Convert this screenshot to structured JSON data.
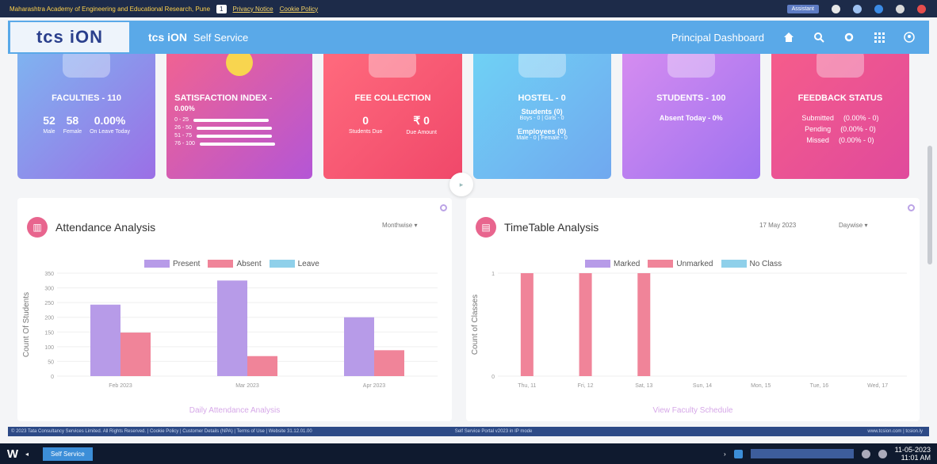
{
  "topbar": {
    "institute": "Maharashtra Academy of Engineering and Educational Research, Pune",
    "user_badge": "1",
    "privacy_link": "Privacy Notice",
    "cookie_link": "Cookie Policy",
    "selector": "Assistant"
  },
  "header": {
    "logo": "tcs iON",
    "app_name": "tcs iON",
    "app_suffix": "Self Service",
    "dashboard": "Principal Dashboard"
  },
  "cards": {
    "faculties": {
      "title": "FACULTIES - 110",
      "male": "52",
      "male_label": "Male",
      "female": "58",
      "female_label": "Female",
      "leave": "0.00%",
      "leave_label": "On Leave Today"
    },
    "satisfaction": {
      "title": "SATISFACTION INDEX -",
      "value": "0.00%",
      "ranges": [
        "0 - 25",
        "26 - 50",
        "51 - 75",
        "76 - 100"
      ]
    },
    "fee": {
      "title": "FEE COLLECTION",
      "due_count": "0",
      "due_label": "Students Due",
      "due_amount": "₹ 0",
      "amount_label": "Due Amount"
    },
    "hostel": {
      "title": "HOSTEL - 0",
      "students": "Students (0)",
      "students_detail": "Boys - 0  |  Girls - 0",
      "employees": "Employees (0)",
      "employees_detail": "Male - 0  |  Female - 0"
    },
    "students": {
      "title": "STUDENTS - 100",
      "absent": "Absent Today - 0%"
    },
    "feedback": {
      "title": "FEEDBACK STATUS",
      "rows": [
        {
          "label": "Submitted",
          "value": "(0.00% - 0)"
        },
        {
          "label": "Pending",
          "value": "(0.00% - 0)"
        },
        {
          "label": "Missed",
          "value": "(0.00% - 0)"
        }
      ]
    }
  },
  "attendance": {
    "title": "Attendance Analysis",
    "dropdown": "Monthwise",
    "footer_link": "Daily Attendance Analysis",
    "legend": [
      "Present",
      "Absent",
      "Leave"
    ]
  },
  "timetable": {
    "title": "TimeTable Analysis",
    "date": "17 May 2023",
    "dropdown": "Daywise",
    "footer_link": "View Faculty Schedule",
    "legend": [
      "Marked",
      "Unmarked",
      "No Class"
    ]
  },
  "chart_data": [
    {
      "type": "bar",
      "categories": [
        "Feb 2023",
        "Mar 2023",
        "Apr 2023"
      ],
      "series": [
        {
          "name": "Present",
          "values": [
            243,
            325,
            200
          ]
        },
        {
          "name": "Absent",
          "values": [
            148,
            68,
            88
          ]
        },
        {
          "name": "Leave",
          "values": [
            0,
            0,
            0
          ]
        }
      ],
      "ylabel": "Count Of Students",
      "yticks": [
        0,
        50,
        100,
        150,
        200,
        250,
        300,
        350
      ],
      "ylim": [
        0,
        350
      ],
      "colors": {
        "Present": "#b79be8",
        "Absent": "#f08499",
        "Leave": "#8fd0ea"
      }
    },
    {
      "type": "bar",
      "categories": [
        "Thu, 11",
        "Fri, 12",
        "Sat, 13",
        "Sun, 14",
        "Mon, 15",
        "Tue, 16",
        "Wed, 17"
      ],
      "series": [
        {
          "name": "Marked",
          "values": [
            0,
            0,
            0,
            0,
            0,
            0,
            0
          ]
        },
        {
          "name": "Unmarked",
          "values": [
            1,
            1,
            1,
            0,
            0,
            0,
            0
          ]
        },
        {
          "name": "No Class",
          "values": [
            0,
            0,
            0,
            0,
            0,
            0,
            0
          ]
        }
      ],
      "ylabel": "Count of Classes",
      "yticks": [
        0,
        1
      ],
      "ylim": [
        0,
        1
      ],
      "colors": {
        "Marked": "#b79be8",
        "Unmarked": "#f08499",
        "No Class": "#8fd0ea"
      }
    }
  ],
  "status_bar": {
    "copyright": "© 2023 Tata Consultancy Services Limited. All Rights Reserved. | Cookie Policy | Customer Details (NPA) | Terms of Use | Website 31.12.01.00",
    "mid": "Self Service Portal v2023 in IP mode",
    "right": "www.tcsion.com | tcsion.ly"
  },
  "taskbar": {
    "start": "W",
    "task": "Self Service",
    "date": "11-05-2023",
    "time": "11:01 AM"
  }
}
